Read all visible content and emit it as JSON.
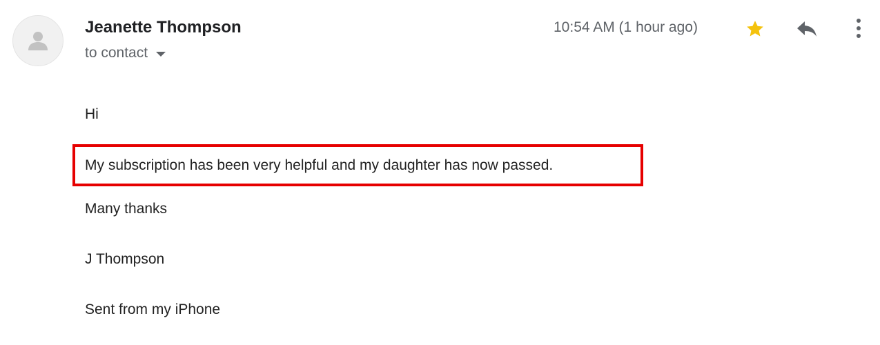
{
  "header": {
    "sender_name": "Jeanette Thompson",
    "recipient_label": "to contact",
    "timestamp": "10:54 AM (1 hour ago)"
  },
  "actions": {
    "star_icon": "star-icon",
    "reply_icon": "reply-icon",
    "more_icon": "more-vert-icon",
    "star_color": "#f4c20d"
  },
  "avatar": {
    "icon": "person-icon"
  },
  "body": {
    "greeting": "Hi",
    "highlighted_line": "My subscription has been very helpful and my daughter has now passed.",
    "thanks": "Many thanks",
    "signature": "J Thompson",
    "sent_from": "Sent from my iPhone"
  },
  "highlight": {
    "color": "#e60000"
  }
}
